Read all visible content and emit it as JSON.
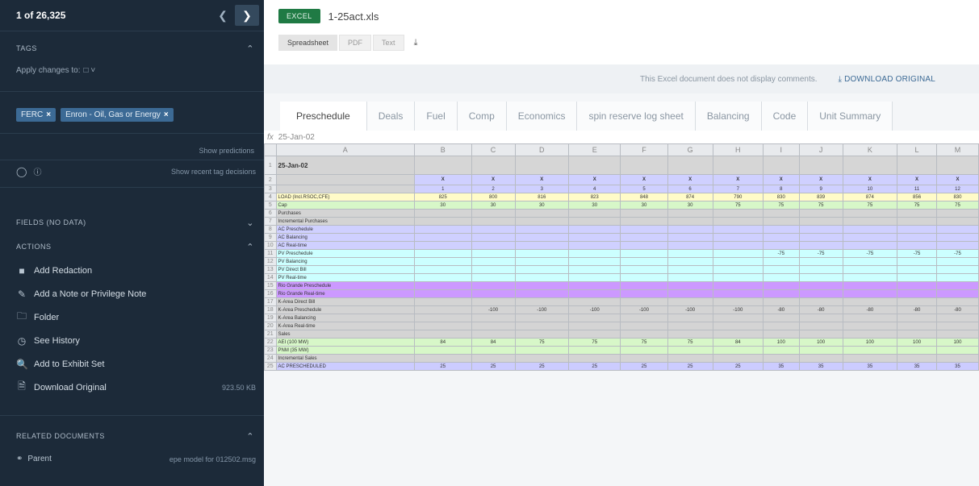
{
  "sidebar": {
    "counter": "1 of 26,325",
    "tags_header": "TAGS",
    "apply_label": "Apply changes to: ",
    "tags": [
      "FERC",
      "Enron - Oil, Gas or Energy"
    ],
    "show_predictions": "Show predictions",
    "show_recent": "Show recent tag decisions",
    "fields_header": "FIELDS (No Data)",
    "actions_header": "ACTIONS",
    "actions": [
      {
        "label": "Add Redaction",
        "icon": "redaction-icon"
      },
      {
        "label": "Add a Note or Privilege Note",
        "icon": "note-icon"
      },
      {
        "label": "Folder",
        "icon": "folder-icon"
      },
      {
        "label": "See History",
        "icon": "history-icon"
      },
      {
        "label": "Add to Exhibit Set",
        "icon": "exhibit-icon"
      },
      {
        "label": "Download Original",
        "icon": "file-icon",
        "size": "923.50 KB"
      }
    ],
    "related_header": "RELATED DOCUMENTS",
    "parent_label": "Parent",
    "parent_value": "epe model for 012502.msg"
  },
  "doc": {
    "badge": "EXCEL",
    "filename": "1-25act.xls",
    "view_tabs": [
      "Spreadsheet",
      "PDF",
      "Text"
    ],
    "info_text": "This Excel document does not display comments.",
    "download_original": "DOWNLOAD ORIGINAL"
  },
  "sheet_tabs": [
    "Preschedule",
    "Deals",
    "Fuel",
    "Comp",
    "Economics",
    "spin reserve log sheet",
    "Balancing",
    "Code",
    "Unit Summary"
  ],
  "formula": {
    "fx": "fx",
    "value": "25-Jan-02"
  },
  "grid": {
    "columns": [
      "A",
      "B",
      "C",
      "D",
      "E",
      "F",
      "G",
      "H",
      "I",
      "J",
      "K",
      "L",
      "M"
    ],
    "row1_label": "25-Jan-02",
    "row2_mark": "X",
    "row3_hours": [
      "1",
      "2",
      "3",
      "4",
      "5",
      "6",
      "7",
      "8",
      "9",
      "10",
      "11",
      "12"
    ],
    "load_label": "LOAD (Incl.RSOC,CFE)",
    "load": [
      "825",
      "800",
      "816",
      "823",
      "848",
      "874",
      "790",
      "830",
      "839",
      "874",
      "856",
      "830"
    ],
    "cap_label": "Cap",
    "cap": [
      "30",
      "30",
      "30",
      "30",
      "30",
      "30",
      "75",
      "75",
      "75",
      "75",
      "75",
      "75"
    ],
    "purchases": "Purchases",
    "incremental": "Incremental Purchases",
    "ac_rows": [
      "AC Preschedule",
      "AC Balancing",
      "AC Real-time"
    ],
    "pv_rows": [
      "PV Preschedule",
      "PV Balancing",
      "PV Direct Bill",
      "PV Real-time"
    ],
    "pv_vals": [
      "-75",
      "-75",
      "-75",
      "-75",
      "-75"
    ],
    "rio_rows": [
      "Rio Grande Preschedule",
      "Rio Grande Real-time"
    ],
    "k_rows": [
      "K-Area Direct Bill",
      "K-Area Preschedule",
      "K-Area Balancing",
      "K-Area Real-time"
    ],
    "k_vals": [
      "-100",
      "-100",
      "-100",
      "-100",
      "-100",
      "-100",
      "-80",
      "-80",
      "-80",
      "-80",
      "-80"
    ],
    "sales": "Sales",
    "s22_label": "AEI (100 MW)",
    "s22": [
      "84",
      "84",
      "75",
      "75",
      "75",
      "75",
      "84",
      "100",
      "100",
      "100",
      "100",
      "100"
    ],
    "s23_label": "PNM (35 MW)",
    "s24_label": "Incremental Sales",
    "s25_label": "AC PRESCHEDULED",
    "s25": [
      "25",
      "25",
      "25",
      "25",
      "25",
      "25",
      "25",
      "35",
      "35",
      "35",
      "35",
      "35"
    ]
  }
}
